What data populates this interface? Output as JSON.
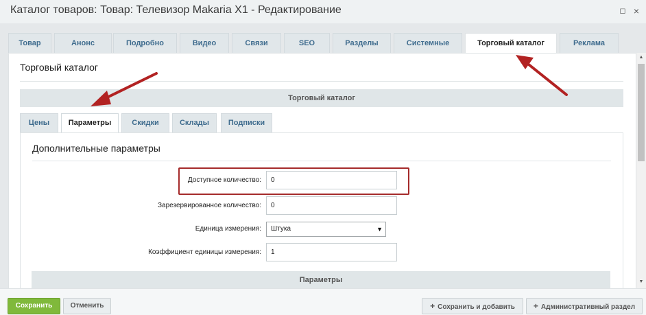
{
  "window": {
    "title": "Каталог товаров: Товар: Телевизор Makaria X1 - Редактирование",
    "maximize_icon": "maximize-icon",
    "close_icon": "close-icon"
  },
  "tabs": [
    {
      "label": "Товар"
    },
    {
      "label": "Анонс"
    },
    {
      "label": "Подробно"
    },
    {
      "label": "Видео"
    },
    {
      "label": "Связи"
    },
    {
      "label": "SEO"
    },
    {
      "label": "Разделы"
    },
    {
      "label": "Системные"
    },
    {
      "label": "Торговый каталог",
      "active": true
    },
    {
      "label": "Реклама"
    }
  ],
  "panel": {
    "title": "Торговый каталог",
    "section_header": "Торговый каталог"
  },
  "subtabs": [
    {
      "label": "Цены"
    },
    {
      "label": "Параметры",
      "active": true
    },
    {
      "label": "Скидки"
    },
    {
      "label": "Склады"
    },
    {
      "label": "Подписки"
    }
  ],
  "subpanel": {
    "title": "Дополнительные параметры",
    "fields": {
      "available_qty": {
        "label": "Доступное количество:",
        "value": "0"
      },
      "reserved_qty": {
        "label": "Зарезервированное количество:",
        "value": "0"
      },
      "unit": {
        "label": "Единица измерения:",
        "value": "Штука"
      },
      "unit_ratio": {
        "label": "Коэффициент единицы измерения:",
        "value": "1"
      }
    },
    "params_header": "Параметры"
  },
  "footer": {
    "save": "Сохранить",
    "cancel": "Отменить",
    "save_add": "Сохранить и добавить",
    "admin": "Административный раздел"
  },
  "colors": {
    "accent_green": "#80b93b",
    "annotation_red": "#b22222",
    "tab_text": "#3f6c8e"
  }
}
